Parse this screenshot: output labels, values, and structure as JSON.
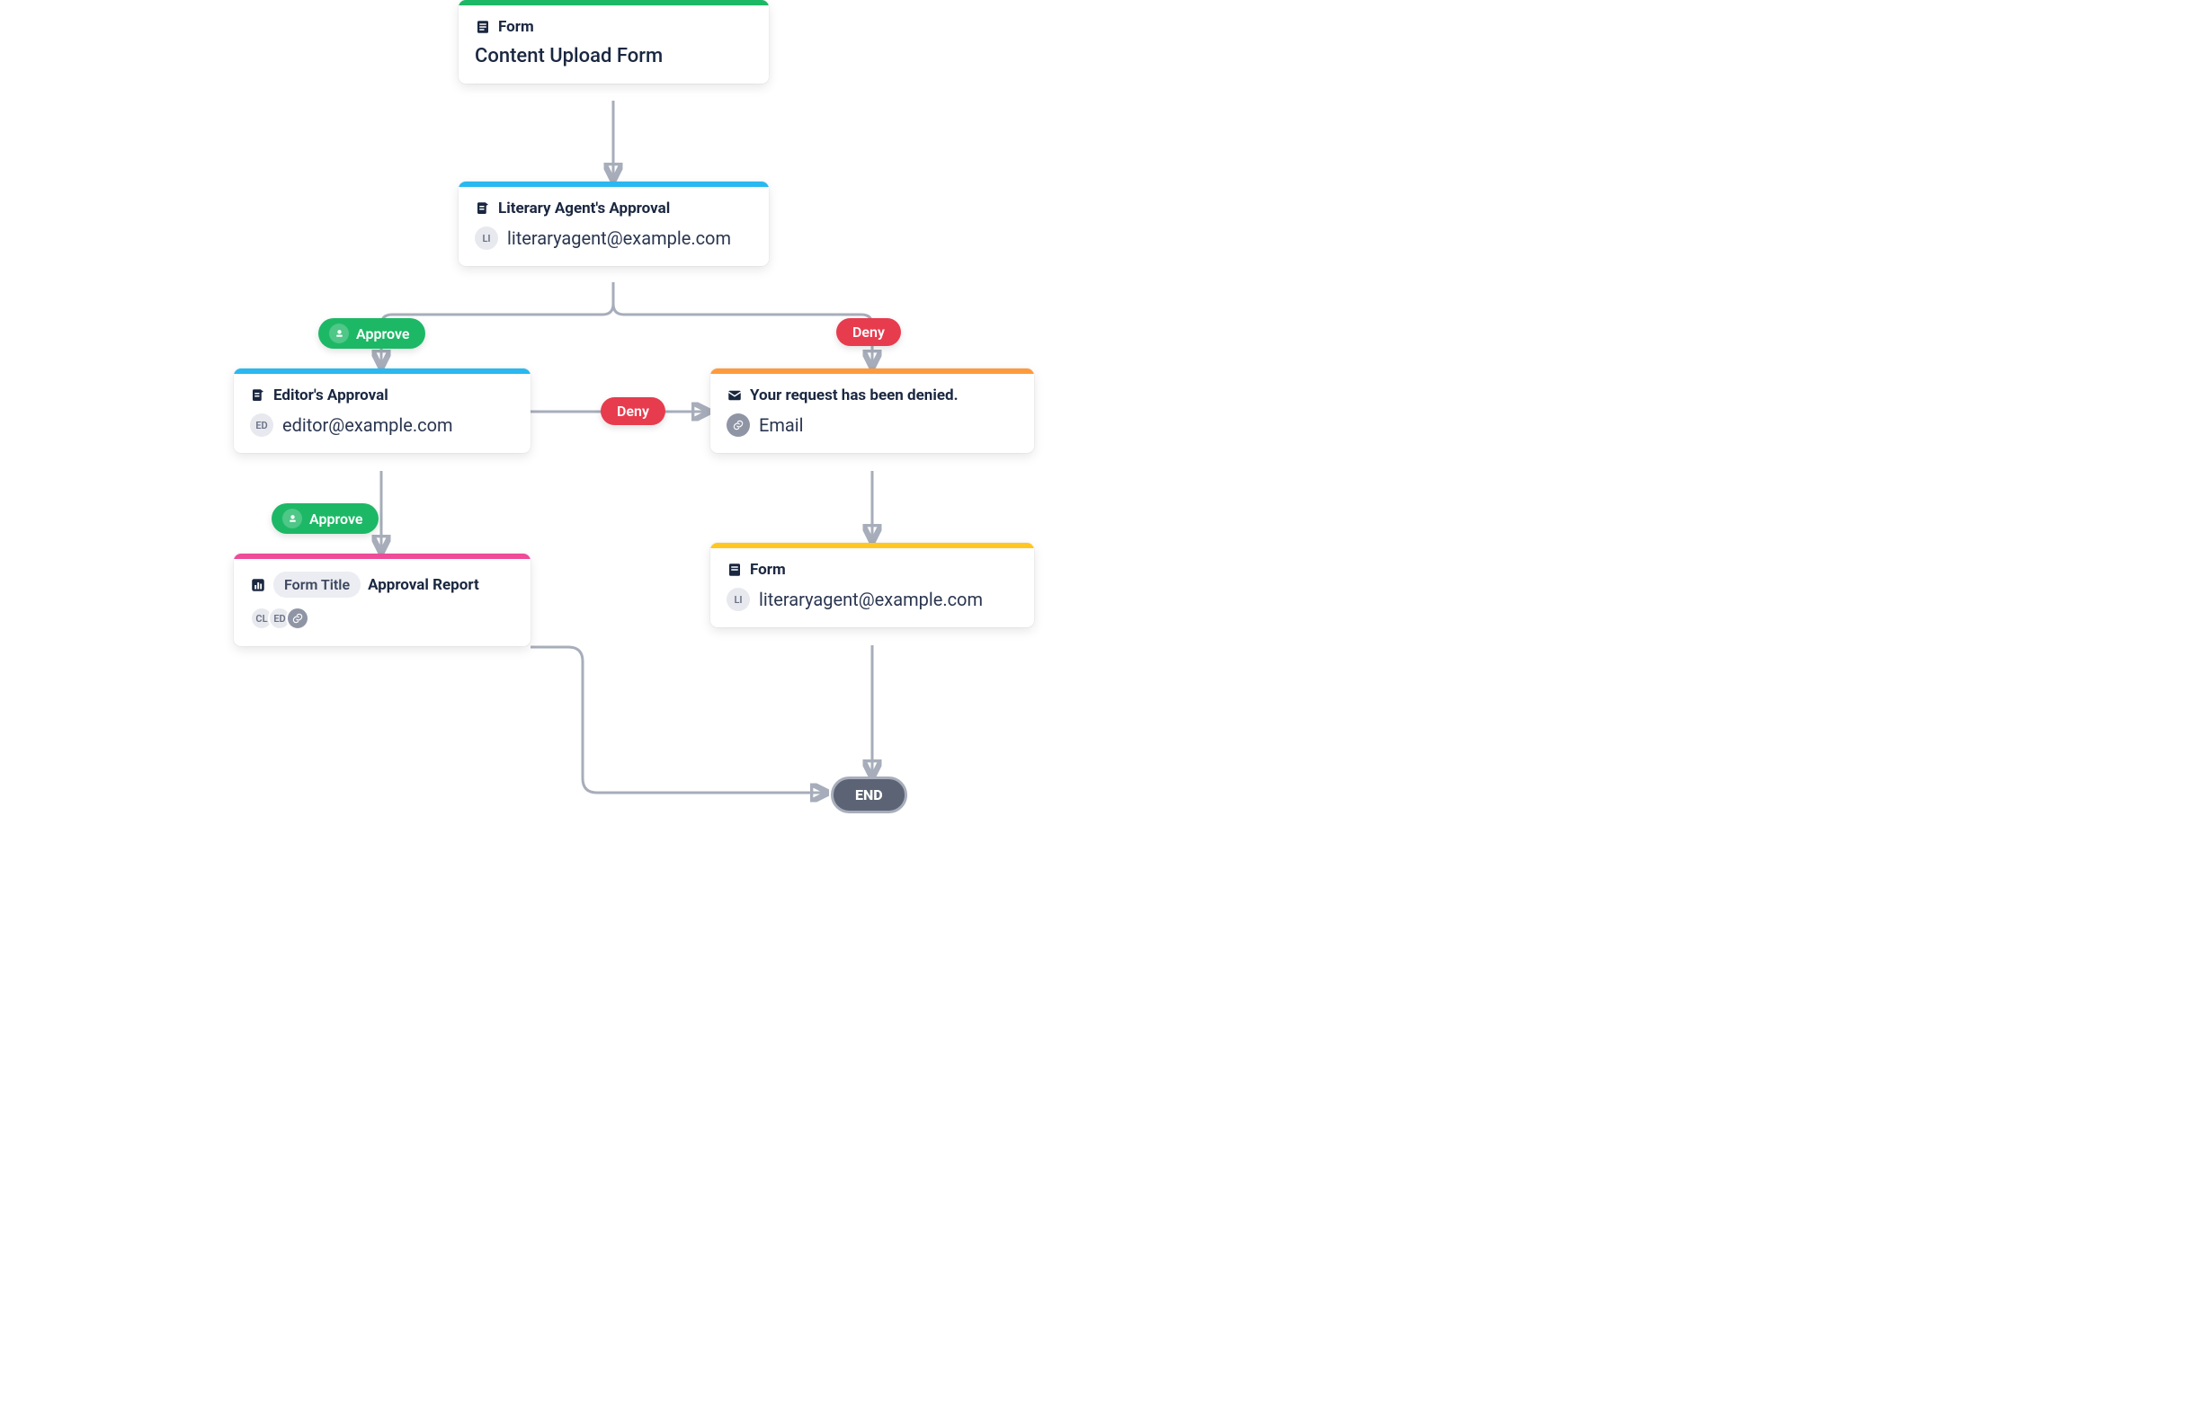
{
  "nodes": {
    "form_start": {
      "type_label": "Form",
      "title": "Content Upload Form"
    },
    "lit_agent": {
      "title": "Literary Agent's Approval",
      "avatar": "LI",
      "email": "literaryagent@example.com"
    },
    "editor": {
      "title": "Editor's Approval",
      "avatar": "ED",
      "email": "editor@example.com"
    },
    "denied": {
      "title": "Your request has been denied.",
      "sub_label": "Email"
    },
    "report": {
      "chip": "Form Title",
      "title": "Approval Report",
      "avatars": [
        "CL",
        "ED"
      ]
    },
    "form_back": {
      "type_label": "Form",
      "avatar": "LI",
      "email": "literaryagent@example.com"
    }
  },
  "pills": {
    "approve1": "Approve",
    "deny1": "Deny",
    "approve2": "Approve",
    "deny2": "Deny"
  },
  "end_label": "END"
}
